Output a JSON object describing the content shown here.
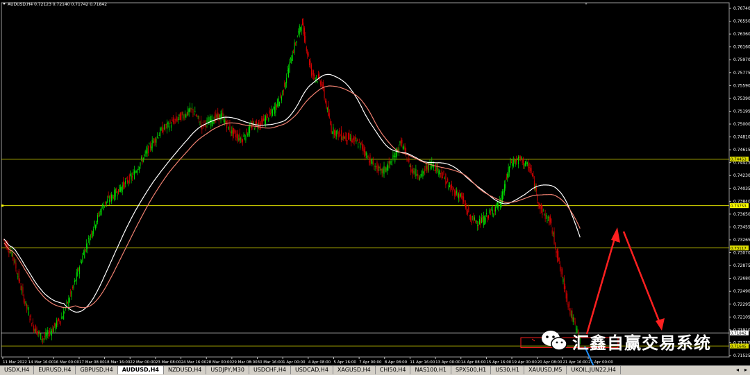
{
  "header": {
    "info": "AUDUSD,H4  0.72123 0.72140 0.71742 0.71842"
  },
  "watermark": {
    "text": "汇鑫自赢交易系统"
  },
  "tabs": [
    {
      "label": "USDX,H4",
      "active": false
    },
    {
      "label": "EURUSD,H4",
      "active": false
    },
    {
      "label": "GBPUSD,H4",
      "active": false
    },
    {
      "label": "AUDUSD,H4",
      "active": true
    },
    {
      "label": "NZDUSD,H4",
      "active": false
    },
    {
      "label": "USDJPY,M30",
      "active": false
    },
    {
      "label": "USDCHF,H4",
      "active": false
    },
    {
      "label": "USDCAD,H4",
      "active": false
    },
    {
      "label": "XAGUSD,H4",
      "active": false
    },
    {
      "label": "CHI50,H4",
      "active": false
    },
    {
      "label": "NAS100,H1",
      "active": false
    },
    {
      "label": "SPX500,H1",
      "active": false
    },
    {
      "label": "US30,H1",
      "active": false
    },
    {
      "label": "XAUUSD,M5",
      "active": false
    },
    {
      "label": "UKOIL.JUN22,H4",
      "active": false
    }
  ],
  "chart_data": {
    "type": "candlestick",
    "symbol": "AUDUSD",
    "timeframe": "H4",
    "ohlc_current": {
      "open": 0.72123,
      "high": 0.7214,
      "low": 0.71742,
      "close": 0.71842
    },
    "ylim": [
      0.7148,
      0.768
    ],
    "y_ticks": [
      "0.76740",
      "0.76550",
      "0.76360",
      "0.76160",
      "0.75970",
      "0.75775",
      "0.75590",
      "0.75390",
      "0.75195",
      "0.75000",
      "0.74810",
      "0.74615",
      "0.74425",
      "0.74230",
      "0.74035",
      "0.73840",
      "0.73650",
      "0.73455",
      "0.73265",
      "0.73070",
      "0.72875",
      "0.72680",
      "0.72490",
      "0.72295",
      "0.72105",
      "0.71910",
      "0.71715",
      "0.71525"
    ],
    "x_ticks": [
      "11 Mar 2022",
      "14 Mar 16:00",
      "16 Mar 00:00",
      "17 Mar 08:00",
      "18 Mar 16:00",
      "22 Mar 00:00",
      "23 Mar 08:00",
      "24 Mar 16:00",
      "28 Mar 00:00",
      "29 Mar 08:00",
      "30 Mar 16:00",
      "1 Apr 00:00",
      "4 Apr 08:00",
      "5 Apr 16:00",
      "7 Apr 00:00",
      "8 Apr 08:00",
      "11 Apr 16:00",
      "13 Apr 00:00",
      "14 Apr 08:00",
      "15 Apr 16:00",
      "19 Apr 00:00",
      "20 Apr 08:00",
      "21 Apr 16:00",
      "25 Apr 00:00"
    ],
    "close_path": [
      0.7325,
      0.73,
      0.724,
      0.7195,
      0.7175,
      0.719,
      0.721,
      0.725,
      0.73,
      0.734,
      0.7375,
      0.739,
      0.7405,
      0.742,
      0.7445,
      0.747,
      0.749,
      0.75,
      0.751,
      0.752,
      0.7495,
      0.7505,
      0.751,
      0.7485,
      0.7475,
      0.7495,
      0.75,
      0.7515,
      0.754,
      0.76,
      0.765,
      0.7575,
      0.756,
      0.749,
      0.748,
      0.7475,
      0.7465,
      0.744,
      0.7425,
      0.744,
      0.747,
      0.743,
      0.742,
      0.744,
      0.7425,
      0.74,
      0.739,
      0.7355,
      0.735,
      0.7365,
      0.738,
      0.744,
      0.7445,
      0.743,
      0.737,
      0.735,
      0.728,
      0.7215,
      0.7175
    ],
    "horizontal_levels": [
      {
        "value": "0.74453",
        "price": 0.74453,
        "color": "#d8d800"
      },
      {
        "value": "0.73753",
        "price": 0.73753,
        "color": "#ffff00"
      },
      {
        "value": "0.73117",
        "price": 0.73117,
        "color": "#d8d800"
      },
      {
        "value": "0.71842",
        "price": 0.71842,
        "color": "#ffffff"
      },
      {
        "value": "0.71645",
        "price": 0.71645,
        "color": "#d8d800"
      }
    ],
    "colors": {
      "bull": "#00e000",
      "bear": "#e00000",
      "ma_fast": "#ffffff",
      "ma_slow": "#f08070",
      "arrow": "#ff2020",
      "projection": "#1e90ff"
    },
    "grid": false
  }
}
